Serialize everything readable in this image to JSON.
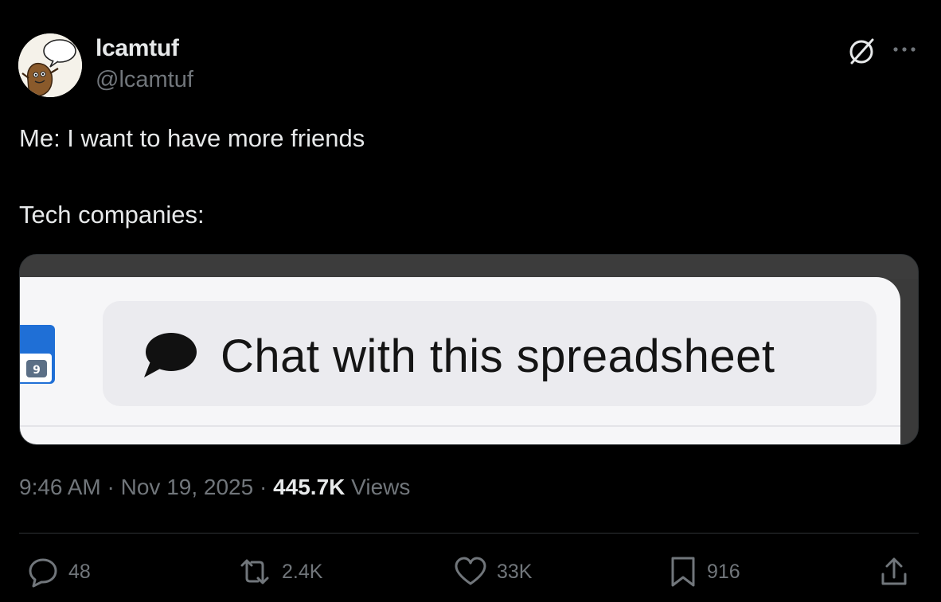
{
  "author": {
    "display_name": "lcamtuf",
    "handle": "@lcamtuf",
    "avatar_icon": "potato-mascot-avatar"
  },
  "header_actions": {
    "grok_icon": "grok-icon",
    "more_icon": "more-options-icon"
  },
  "tweet": {
    "line1": "Me: I want to have more friends",
    "line2": "Tech companies:"
  },
  "media": {
    "chip_label": "Chat with this spreadsheet",
    "chat_icon": "chat-bubble-icon",
    "sheet_badge": "9"
  },
  "meta": {
    "time": "9:46 AM",
    "separator": "·",
    "date": "Nov 19, 2025",
    "views_count": "445.7K",
    "views_label": "Views"
  },
  "actions": {
    "replies": "48",
    "reposts": "2.4K",
    "likes": "33K",
    "bookmarks": "916"
  },
  "colors": {
    "background": "#000000",
    "primary_text": "#e7e9ea",
    "secondary_text": "#71767b",
    "divider": "#2f3336"
  }
}
